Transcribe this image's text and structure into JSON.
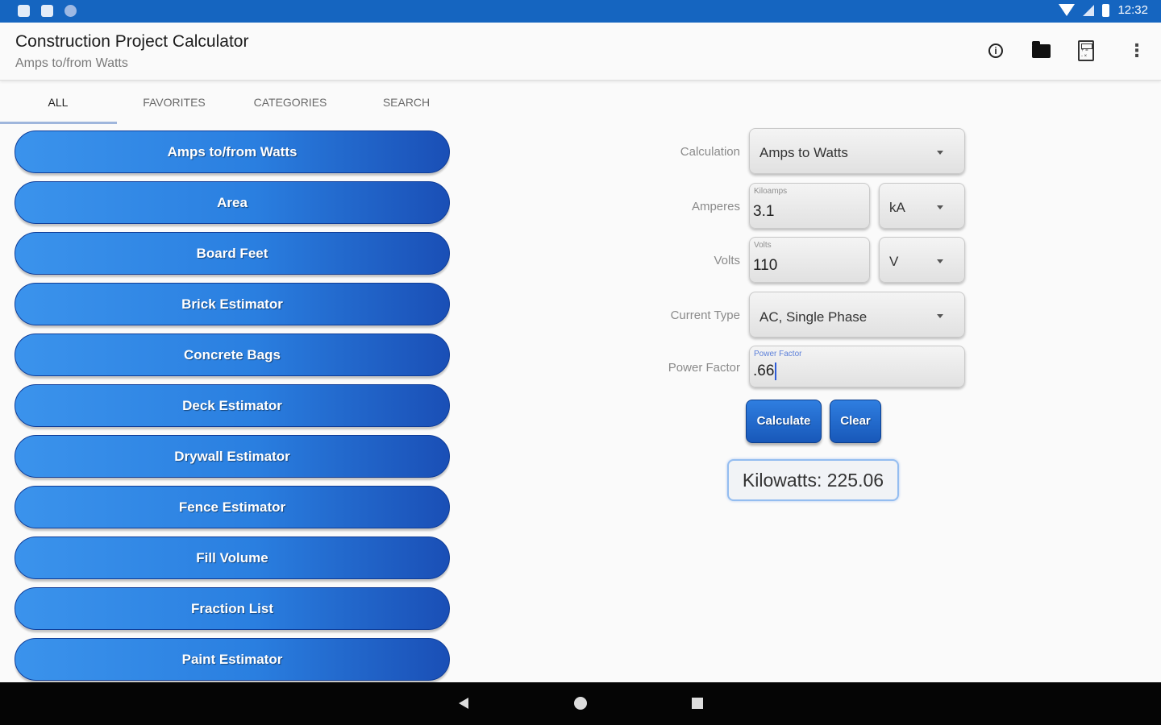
{
  "status_bar": {
    "time": "12:32"
  },
  "app_bar": {
    "title": "Construction Project Calculator",
    "subtitle": "Amps to/from Watts",
    "actions": [
      "info-icon",
      "folder-icon",
      "calculator-icon",
      "more-vert-icon"
    ]
  },
  "tabs": [
    {
      "label": "ALL",
      "active": true
    },
    {
      "label": "FAVORITES",
      "active": false
    },
    {
      "label": "CATEGORIES",
      "active": false
    },
    {
      "label": "SEARCH",
      "active": false
    }
  ],
  "calculators": [
    "Amps to/from Watts",
    "Area",
    "Board Feet",
    "Brick Estimator",
    "Concrete Bags",
    "Deck Estimator",
    "Drywall Estimator",
    "Fence Estimator",
    "Fill Volume",
    "Fraction List",
    "Paint Estimator"
  ],
  "form": {
    "calculation": {
      "label": "Calculation",
      "value": "Amps to Watts"
    },
    "amperes": {
      "label": "Amperes",
      "hint": "Kiloamps",
      "value": "3.1",
      "unit": "kA"
    },
    "volts": {
      "label": "Volts",
      "hint": "Volts",
      "value": "110",
      "unit": "V"
    },
    "current_type": {
      "label": "Current Type",
      "value": "AC, Single Phase"
    },
    "power_factor": {
      "label": "Power Factor",
      "hint": "Power Factor",
      "value": ".66"
    },
    "calculate_label": "Calculate",
    "clear_label": "Clear",
    "result": "Kilowatts: 225.06"
  },
  "colors": {
    "status_bar": "#1565c0",
    "button_light": "#3b93ec",
    "button_dark": "#1a4fb6",
    "result_border": "#94bdf0"
  }
}
